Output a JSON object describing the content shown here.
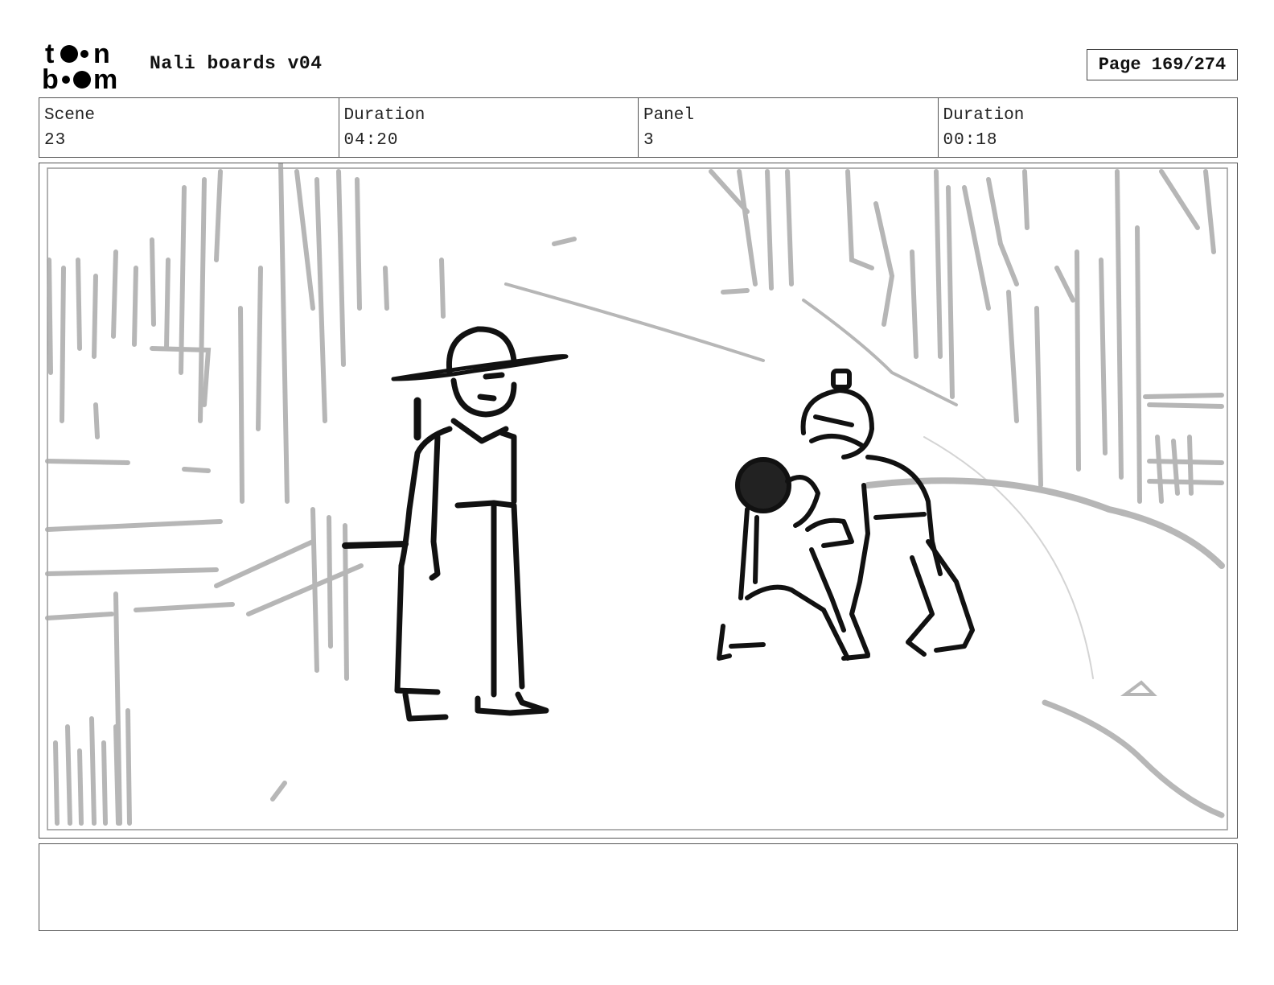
{
  "header": {
    "logo_alt": "toon boom",
    "project_title": "Nali boards v04",
    "page_label": "Page 169/274"
  },
  "info": {
    "scene_label": "Scene",
    "scene_value": "23",
    "scene_duration_label": "Duration",
    "scene_duration_value": "04:20",
    "panel_label": "Panel",
    "panel_value": "3",
    "panel_duration_label": "Duration",
    "panel_duration_value": "00:18"
  },
  "notes": {
    "text": ""
  }
}
